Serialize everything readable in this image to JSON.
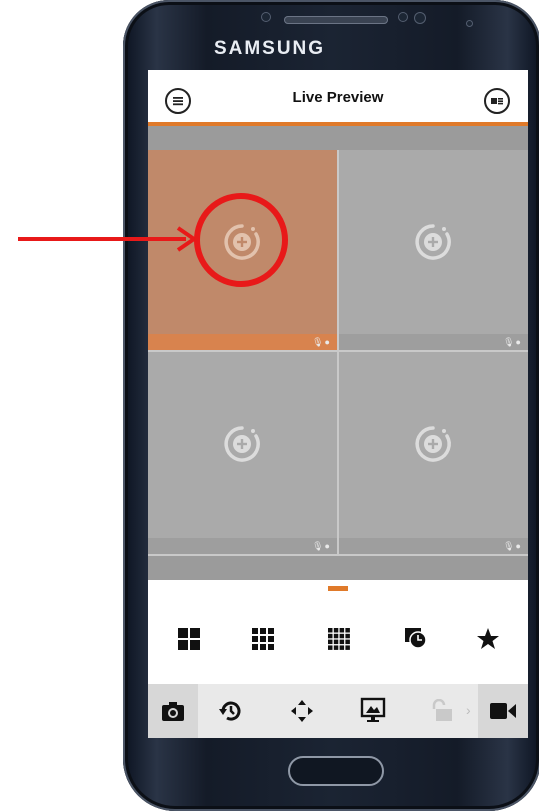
{
  "device": {
    "brand": "SAMSUNG",
    "frame_color": "#1b2433"
  },
  "app": {
    "title": "Live Preview",
    "accent": "#e07a2a"
  },
  "header": {
    "menu_icon": "hamburger-menu-icon",
    "device_list_icon": "device-list-icon"
  },
  "grid": {
    "tiles": [
      {
        "id": "channel-1",
        "selected": true,
        "icon": "add-channel-icon"
      },
      {
        "id": "channel-2",
        "selected": false,
        "icon": "add-channel-icon"
      },
      {
        "id": "channel-3",
        "selected": false,
        "icon": "add-channel-icon"
      },
      {
        "id": "channel-4",
        "selected": false,
        "icon": "add-channel-icon"
      }
    ],
    "selected_tile_color": "#c0896a",
    "tile_color": "#aaaaaa"
  },
  "layout_options": [
    {
      "icon": "grid-4-icon"
    },
    {
      "icon": "grid-9-icon"
    },
    {
      "icon": "grid-16-icon"
    },
    {
      "icon": "playback-timer-icon"
    },
    {
      "icon": "favorite-star-icon"
    }
  ],
  "toolbar": [
    {
      "icon": "snapshot-camera-icon"
    },
    {
      "icon": "playback-history-icon"
    },
    {
      "icon": "ptz-direction-icon"
    },
    {
      "icon": "image-quality-icon"
    },
    {
      "icon": "unlock-icon",
      "disabled": true
    },
    {
      "icon": "record-video-icon"
    }
  ],
  "annotation": {
    "color": "#e81919",
    "target": "channel-1 add-channel-icon"
  }
}
